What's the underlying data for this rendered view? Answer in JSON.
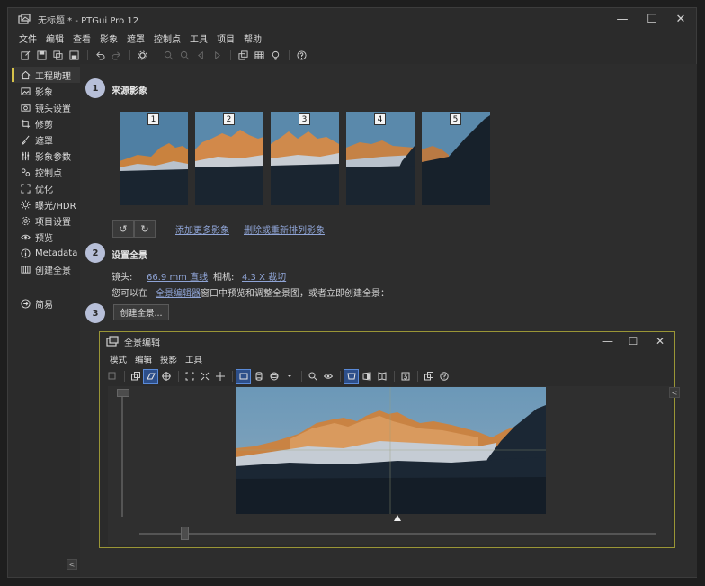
{
  "window": {
    "title": "无标题 * - PTGui Pro 12",
    "min_label": "—",
    "max_label": "☐",
    "close_label": "✕"
  },
  "menu": [
    "文件",
    "编辑",
    "查看",
    "影象",
    "遮罩",
    "控制点",
    "工具",
    "项目",
    "帮助"
  ],
  "toolbar_icons": [
    "new-project-icon",
    "open-icon",
    "copy-icon",
    "save-icon",
    "undo-icon",
    "redo-icon",
    "settings-icon",
    "zoom-in-icon",
    "zoom-out-icon",
    "prev-icon",
    "next-icon",
    "panorama-editor-icon",
    "table-icon",
    "lightbulb-icon",
    "help-icon"
  ],
  "sidebar": {
    "items": [
      {
        "label": "工程助理",
        "icon": "home-icon"
      },
      {
        "label": "影象",
        "icon": "image-icon"
      },
      {
        "label": "镜头设置",
        "icon": "camera-icon"
      },
      {
        "label": "修剪",
        "icon": "crop-icon"
      },
      {
        "label": "遮罩",
        "icon": "brush-icon"
      },
      {
        "label": "影象参数",
        "icon": "sliders-icon"
      },
      {
        "label": "控制点",
        "icon": "control-points-icon"
      },
      {
        "label": "优化",
        "icon": "optimize-icon"
      },
      {
        "label": "曝光/HDR",
        "icon": "sun-icon"
      },
      {
        "label": "项目设置",
        "icon": "gear-icon"
      },
      {
        "label": "预览",
        "icon": "eye-icon"
      },
      {
        "label": "Metadata",
        "icon": "info-icon"
      },
      {
        "label": "创建全景",
        "icon": "book-icon"
      }
    ],
    "simple": {
      "label": "简易",
      "icon": "arrow-circle-icon"
    },
    "collapse_label": "<"
  },
  "assistant": {
    "step1": {
      "num": "1",
      "title": "来源影象"
    },
    "images": [
      "1",
      "2",
      "3",
      "4",
      "5"
    ],
    "rotate_left": "↺",
    "rotate_right": "↻",
    "add_more": "添加更多影象",
    "remove_reorder": "删除或重新排列影象",
    "step2": {
      "num": "2",
      "title": "设置全景"
    },
    "lens_label": "镜头:",
    "lens_value": "66.9 mm 直线",
    "camera_label": "相机:",
    "camera_value": "4.3 X 裁切",
    "hint_before": "您可以在",
    "hint_link": "全景编辑器",
    "hint_after": "窗口中预览和调整全景图，或者立即创建全景：",
    "step3": {
      "num": "3"
    },
    "create_button": "创建全景..."
  },
  "editor": {
    "title": "全景编辑",
    "min_label": "—",
    "max_label": "☐",
    "close_label": "✕",
    "menu": [
      "模式",
      "编辑",
      "投影",
      "工具"
    ],
    "toolbar_icons": [
      "select-icon",
      "layers-icon",
      "fit-icon",
      "center-icon",
      "expand-icon",
      "shrink-icon",
      "straighten-icon",
      "rectilinear-icon",
      "cylinder-icon",
      "sphere-icon",
      "dropdown-icon",
      "zoom-icon",
      "eye-icon",
      "projection-flat-icon",
      "projection-a-icon",
      "projection-b-icon",
      "three-d-icon",
      "window-icon",
      "help-icon"
    ],
    "side_label": "<"
  },
  "colors": {
    "accent": "#d6c24a",
    "link": "#8fa4d6",
    "step": "#b7bfd8",
    "editor_border": "#9a9636",
    "selected": "#2d4f8a"
  }
}
